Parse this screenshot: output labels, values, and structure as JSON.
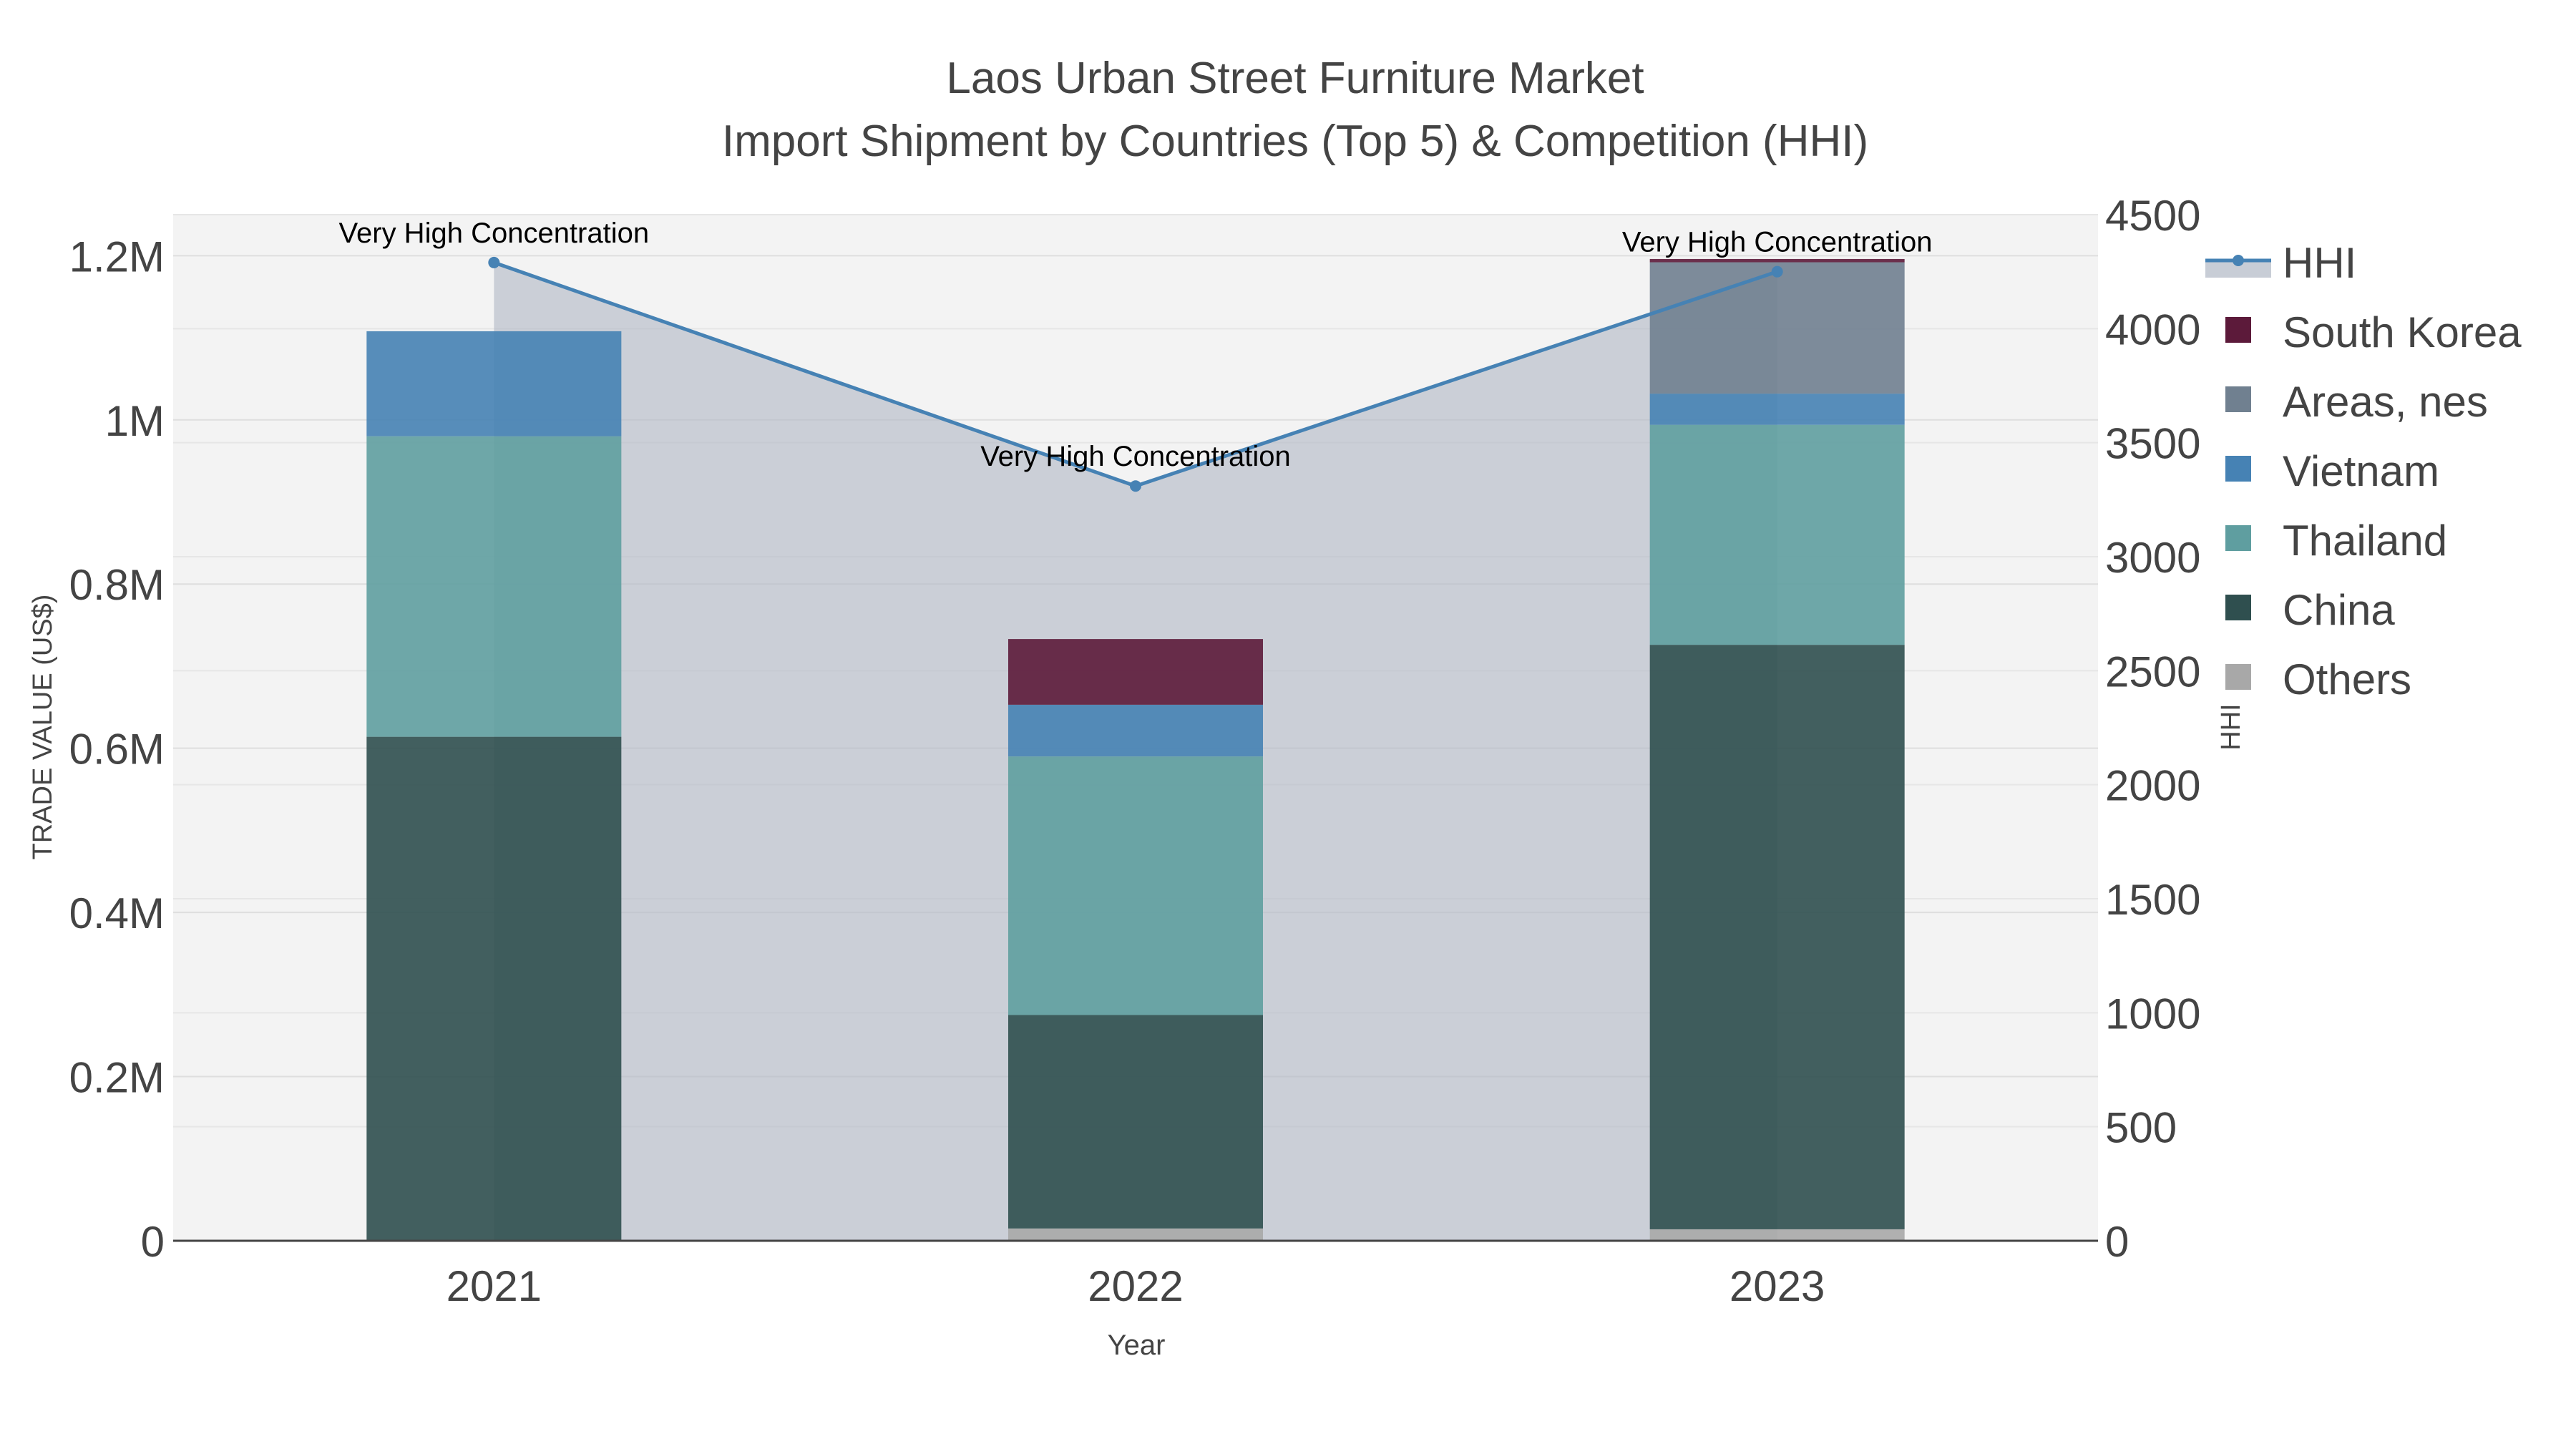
{
  "title_line1": "Laos Urban Street Furniture Market",
  "title_line2": "Import Shipment by Countries (Top 5) & Competition (HHI)",
  "chart_data": {
    "type": "bar",
    "barmode": "stack",
    "categories": [
      "2021",
      "2022",
      "2023"
    ],
    "xlabel": "Year",
    "ylabel": "TRADE VALUE (US$)",
    "y2label": "HHI",
    "ylim": [
      0,
      1250000
    ],
    "y2lim": [
      0,
      4500
    ],
    "yticks": [
      {
        "value": 0,
        "label": "0"
      },
      {
        "value": 200000,
        "label": "0.2M"
      },
      {
        "value": 400000,
        "label": "0.4M"
      },
      {
        "value": 600000,
        "label": "0.6M"
      },
      {
        "value": 800000,
        "label": "0.8M"
      },
      {
        "value": 1000000,
        "label": "1M"
      },
      {
        "value": 1200000,
        "label": "1.2M"
      }
    ],
    "y2ticks": [
      {
        "value": 0,
        "label": "0"
      },
      {
        "value": 500,
        "label": "500"
      },
      {
        "value": 1000,
        "label": "1000"
      },
      {
        "value": 1500,
        "label": "1500"
      },
      {
        "value": 2000,
        "label": "2000"
      },
      {
        "value": 2500,
        "label": "2500"
      },
      {
        "value": 3000,
        "label": "3000"
      },
      {
        "value": 3500,
        "label": "3500"
      },
      {
        "value": 4000,
        "label": "4000"
      },
      {
        "value": 4500,
        "label": "4500"
      }
    ],
    "series": [
      {
        "name": "Others",
        "color": "#a8a8a8",
        "values": [
          0,
          15000,
          14000
        ]
      },
      {
        "name": "China",
        "color": "#2f4f4f",
        "values": [
          614000,
          260000,
          712000
        ]
      },
      {
        "name": "Thailand",
        "color": "#5f9ea0",
        "values": [
          366000,
          315000,
          268000
        ]
      },
      {
        "name": "Vietnam",
        "color": "#4682b4",
        "values": [
          128000,
          63000,
          38000
        ]
      },
      {
        "name": "Areas, nes",
        "color": "#708090",
        "values": [
          0,
          0,
          160000
        ]
      },
      {
        "name": "South Korea",
        "color": "#5c1a3a",
        "values": [
          0,
          80000,
          4000
        ]
      }
    ],
    "hhi": {
      "name": "HHI",
      "color": "#4682b4",
      "values": [
        4290,
        3310,
        4250
      ],
      "annotations": [
        "Very High Concentration",
        "Very High Concentration",
        "Very High Concentration"
      ]
    },
    "legend": [
      "HHI",
      "South Korea",
      "Areas, nes",
      "Vietnam",
      "Thailand",
      "China",
      "Others"
    ],
    "legend_position": "top-right",
    "grid": true
  }
}
